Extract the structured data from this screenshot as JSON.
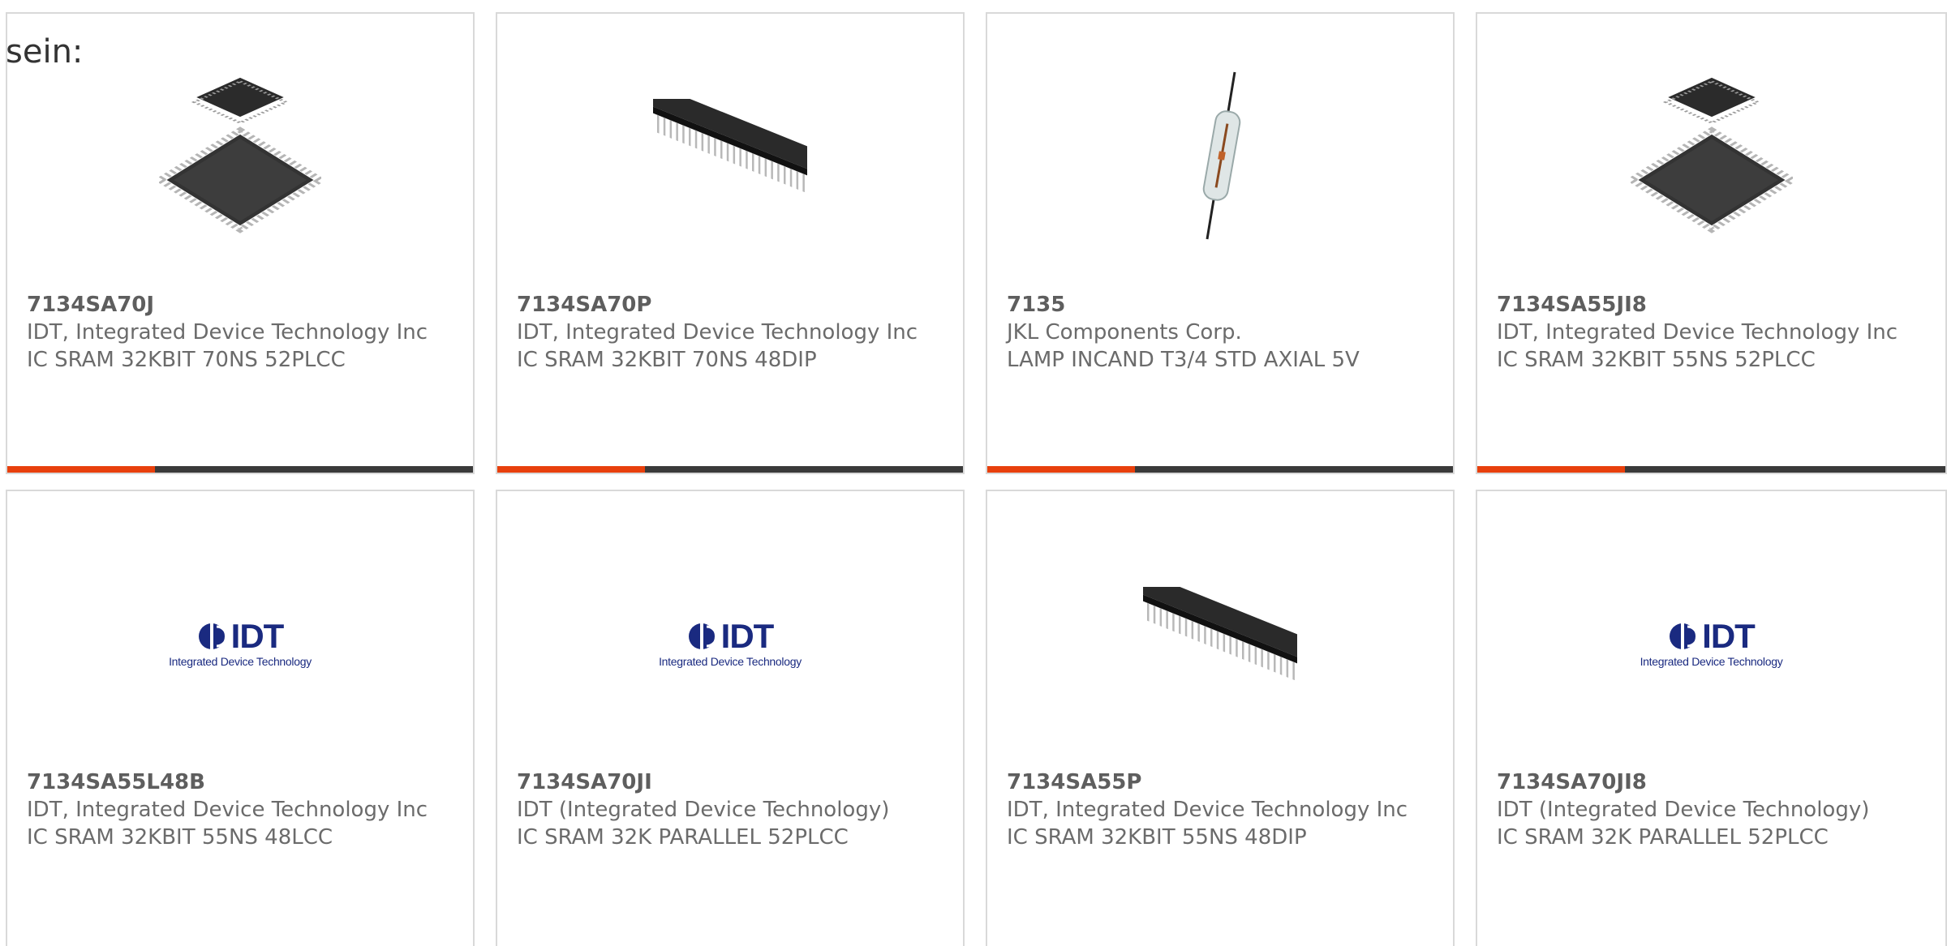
{
  "intro_text": "sein:",
  "colors": {
    "accent": "#e8400c",
    "bar": "#3a3a3a",
    "border": "#d9d9d9",
    "text": "#6b6b6b",
    "logo_blue": "#1a2a80"
  },
  "products": [
    {
      "part": "7134SA70J",
      "manufacturer": "IDT, Integrated Device Technology Inc",
      "description": "IC SRAM 32KBIT 70NS 52PLCC",
      "image": "plcc-chip-image"
    },
    {
      "part": "7134SA70P",
      "manufacturer": "IDT, Integrated Device Technology Inc",
      "description": "IC SRAM 32KBIT 70NS 48DIP",
      "image": "dip-chip-image"
    },
    {
      "part": "7135",
      "manufacturer": "JKL Components Corp.",
      "description": "LAMP INCAND T3/4 STD AXIAL 5V",
      "image": "axial-lamp-image"
    },
    {
      "part": "7134SA55JI8",
      "manufacturer": "IDT, Integrated Device Technology Inc",
      "description": "IC SRAM 32KBIT 55NS 52PLCC",
      "image": "plcc-chip-image"
    },
    {
      "part": "7134SA55L48B",
      "manufacturer": "IDT, Integrated Device Technology Inc",
      "description": "IC SRAM 32KBIT 55NS 48LCC",
      "image": "idt-logo",
      "logo_text": "IDT",
      "logo_tagline": "Integrated Device Technology"
    },
    {
      "part": "7134SA70JI",
      "manufacturer": "IDT (Integrated Device Technology)",
      "description": "IC SRAM 32K PARALLEL 52PLCC",
      "image": "idt-logo",
      "logo_text": "IDT",
      "logo_tagline": "Integrated Device Technology"
    },
    {
      "part": "7134SA55P",
      "manufacturer": "IDT, Integrated Device Technology Inc",
      "description": "IC SRAM 32KBIT 55NS 48DIP",
      "image": "dip-chip-image"
    },
    {
      "part": "7134SA70JI8",
      "manufacturer": "IDT (Integrated Device Technology)",
      "description": "IC SRAM 32K PARALLEL 52PLCC",
      "image": "idt-logo",
      "logo_text": "IDT",
      "logo_tagline": "Integrated Device Technology"
    }
  ]
}
